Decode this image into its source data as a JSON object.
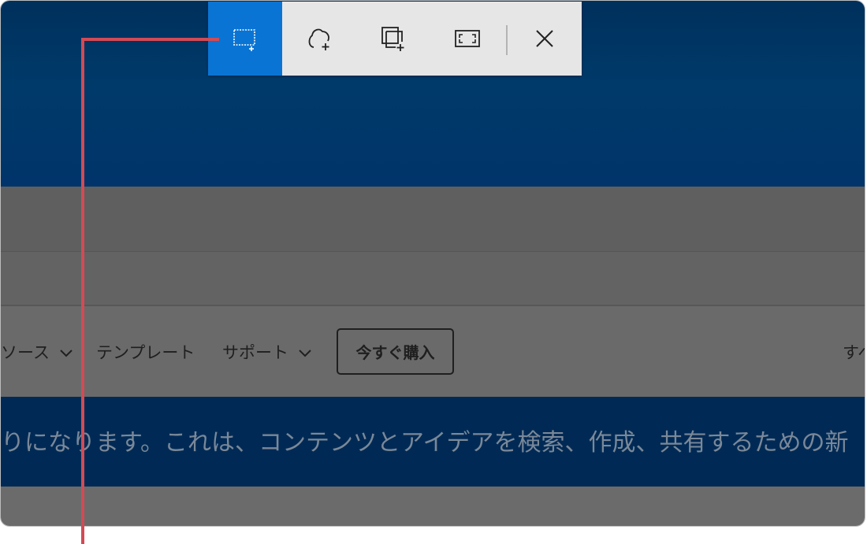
{
  "nav": {
    "resources": "ソース",
    "templates": "テンプレート",
    "support": "サポート",
    "buy_now": "今すぐ購入",
    "right_cut": "すべ"
  },
  "banner_text": "りになります。これは、コンテンツとアイデアを検索、作成、共有するための新",
  "snip_toolbar": {
    "modes": [
      {
        "name": "rectangle-snip",
        "icon": "rectangle-snip-icon",
        "selected": true
      },
      {
        "name": "freeform-snip",
        "icon": "freeform-snip-icon",
        "selected": false
      },
      {
        "name": "window-snip",
        "icon": "window-snip-icon",
        "selected": false
      },
      {
        "name": "fullscreen-snip",
        "icon": "fullscreen-snip-icon",
        "selected": false
      }
    ],
    "close_icon": "close-icon"
  },
  "colors": {
    "active": "#0a74d4",
    "toolbar_bg": "#e6e6e6",
    "callout": "#d24b55",
    "banner": "#003a6a"
  }
}
